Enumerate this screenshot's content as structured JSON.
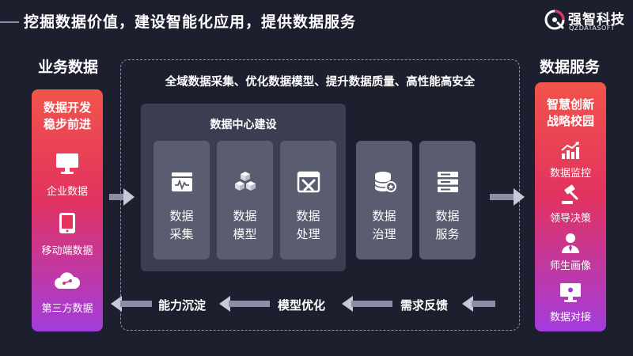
{
  "header": {
    "title": "挖掘数据价值，建设智能化应用，提供数据服务"
  },
  "logo": {
    "name": "强智科技",
    "subtitle": "QZDATASOFT"
  },
  "left": {
    "heading": "业务数据",
    "card_title": "数据开发\n稳步前进",
    "items": [
      {
        "label": "企业数据",
        "icon": "monitor-icon"
      },
      {
        "label": "移动端数据",
        "icon": "tablet-icon"
      },
      {
        "label": "第三方数据",
        "icon": "cloud-icon"
      }
    ]
  },
  "center": {
    "title": "全域数据采集、优化数据模型、提升数据质量、高性能高安全",
    "dc_label": "数据中心建设",
    "cards": [
      {
        "label": "数据\n采集",
        "icon": "collect-icon"
      },
      {
        "label": "数据\n模型",
        "icon": "cubes-icon"
      },
      {
        "label": "数据\n处理",
        "icon": "tools-icon"
      },
      {
        "label": "数据\n治理",
        "icon": "database-icon"
      },
      {
        "label": "数据\n服务",
        "icon": "server-icon"
      }
    ],
    "flow": [
      "需求反馈",
      "模型优化",
      "能力沉淀"
    ]
  },
  "right": {
    "heading": "数据服务",
    "card_title": "智慧创新\n战略校园",
    "items": [
      {
        "label": "数据监控",
        "icon": "chart-up-icon"
      },
      {
        "label": "领导决策",
        "icon": "gavel-icon"
      },
      {
        "label": "师生画像",
        "icon": "person-icon"
      },
      {
        "label": "数据对接",
        "icon": "screen-icon"
      }
    ]
  },
  "colors": {
    "background": "#1d1f2e",
    "gradient_top": "#f2544a",
    "gradient_bottom": "#a33cdc",
    "card": "#5a5d70",
    "panel": "#3b3e51"
  }
}
